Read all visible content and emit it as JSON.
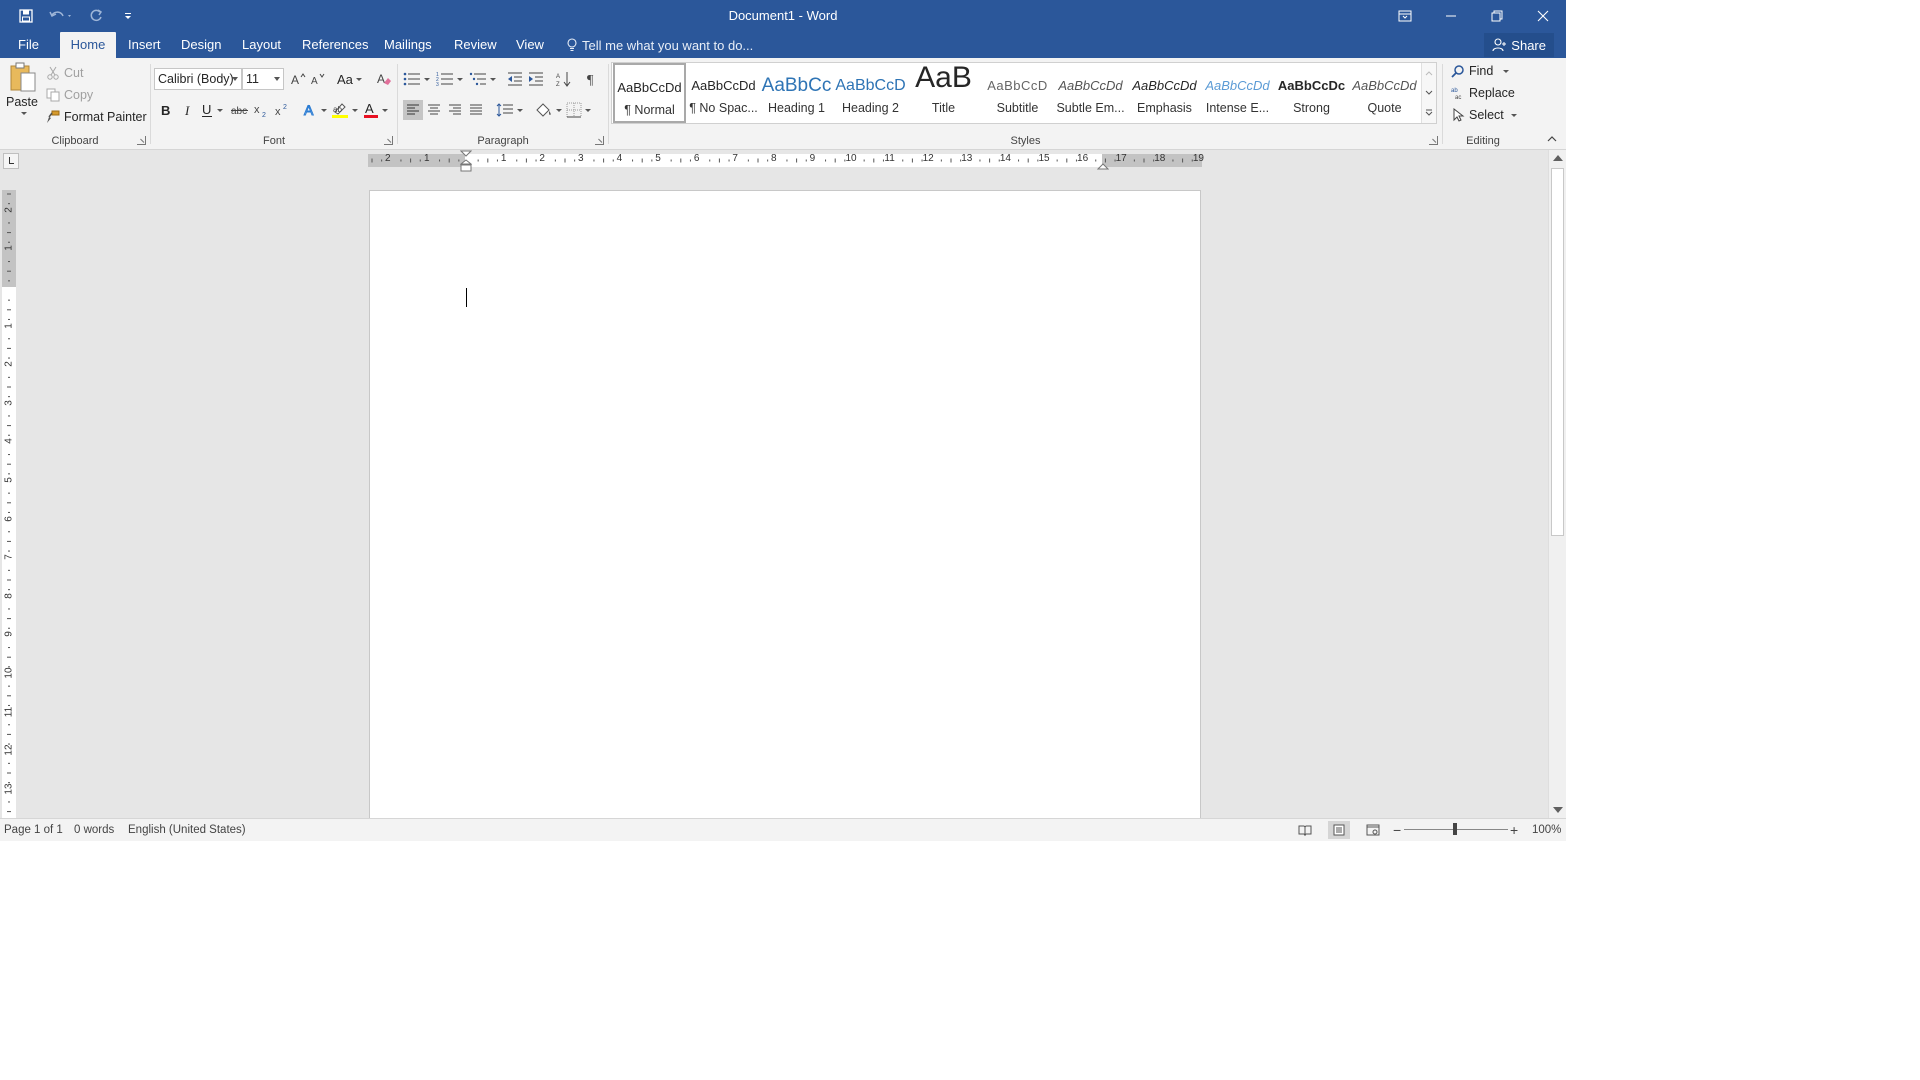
{
  "window": {
    "title": "Document1 - Word"
  },
  "quick_access": {
    "save_icon": "save-icon",
    "undo_icon": "undo-icon",
    "redo_icon": "redo-icon",
    "customize_icon": "customize-qat-icon"
  },
  "tabs": [
    "File",
    "Home",
    "Insert",
    "Design",
    "Layout",
    "References",
    "Mailings",
    "Review",
    "View"
  ],
  "active_tab": "Home",
  "tell_me": "Tell me what you want to do...",
  "share": "Share",
  "clipboard": {
    "paste": "Paste",
    "cut": "Cut",
    "copy": "Copy",
    "format_painter": "Format Painter",
    "label": "Clipboard"
  },
  "font": {
    "name": "Calibri (Body)",
    "size": "11",
    "change_case": "Aa",
    "label": "Font",
    "text_effects": "A",
    "font_color": "A",
    "font_color_hex": "#e81123",
    "highlight_hex": "#ffff00"
  },
  "paragraph": {
    "label": "Paragraph"
  },
  "styles": {
    "label": "Styles",
    "items": [
      {
        "sample": "AaBbCcDd",
        "name": "¶ Normal"
      },
      {
        "sample": "AaBbCcDd",
        "name": "¶ No Spac..."
      },
      {
        "sample": "AaBbCc",
        "name": "Heading 1"
      },
      {
        "sample": "AaBbCcD",
        "name": "Heading 2"
      },
      {
        "sample": "AaB",
        "name": "Title"
      },
      {
        "sample": "AaBbCcD",
        "name": "Subtitle"
      },
      {
        "sample": "AaBbCcDd",
        "name": "Subtle Em..."
      },
      {
        "sample": "AaBbCcDd",
        "name": "Emphasis"
      },
      {
        "sample": "AaBbCcDd",
        "name": "Intense E..."
      },
      {
        "sample": "AaBbCcDc",
        "name": "Strong"
      },
      {
        "sample": "AaBbCcDd",
        "name": "Quote"
      }
    ],
    "selected": 0
  },
  "editing": {
    "find": "Find",
    "replace": "Replace",
    "select": "Select",
    "label": "Editing"
  },
  "ruler": {
    "h_left_numbers": [
      "2",
      "1"
    ],
    "h_right_numbers": [
      "1",
      "2",
      "3",
      "4",
      "5",
      "6",
      "7",
      "8",
      "9",
      "10",
      "11",
      "12",
      "13",
      "14",
      "15",
      "16",
      "17",
      "18",
      "19"
    ],
    "v_top_numbers": [
      "2",
      "1"
    ],
    "v_numbers": [
      "1",
      "2",
      "3",
      "4",
      "5",
      "6",
      "7",
      "8",
      "9",
      "10",
      "11",
      "12",
      "13"
    ]
  },
  "status": {
    "page": "Page 1 of 1",
    "words": "0 words",
    "language": "English (United States)",
    "zoom": "100%",
    "zoom_minus": "−",
    "zoom_plus": "+"
  },
  "colors": {
    "brand": "#2b579a",
    "ribbon": "#f3f3f3",
    "workspace": "#e6e6e6"
  }
}
